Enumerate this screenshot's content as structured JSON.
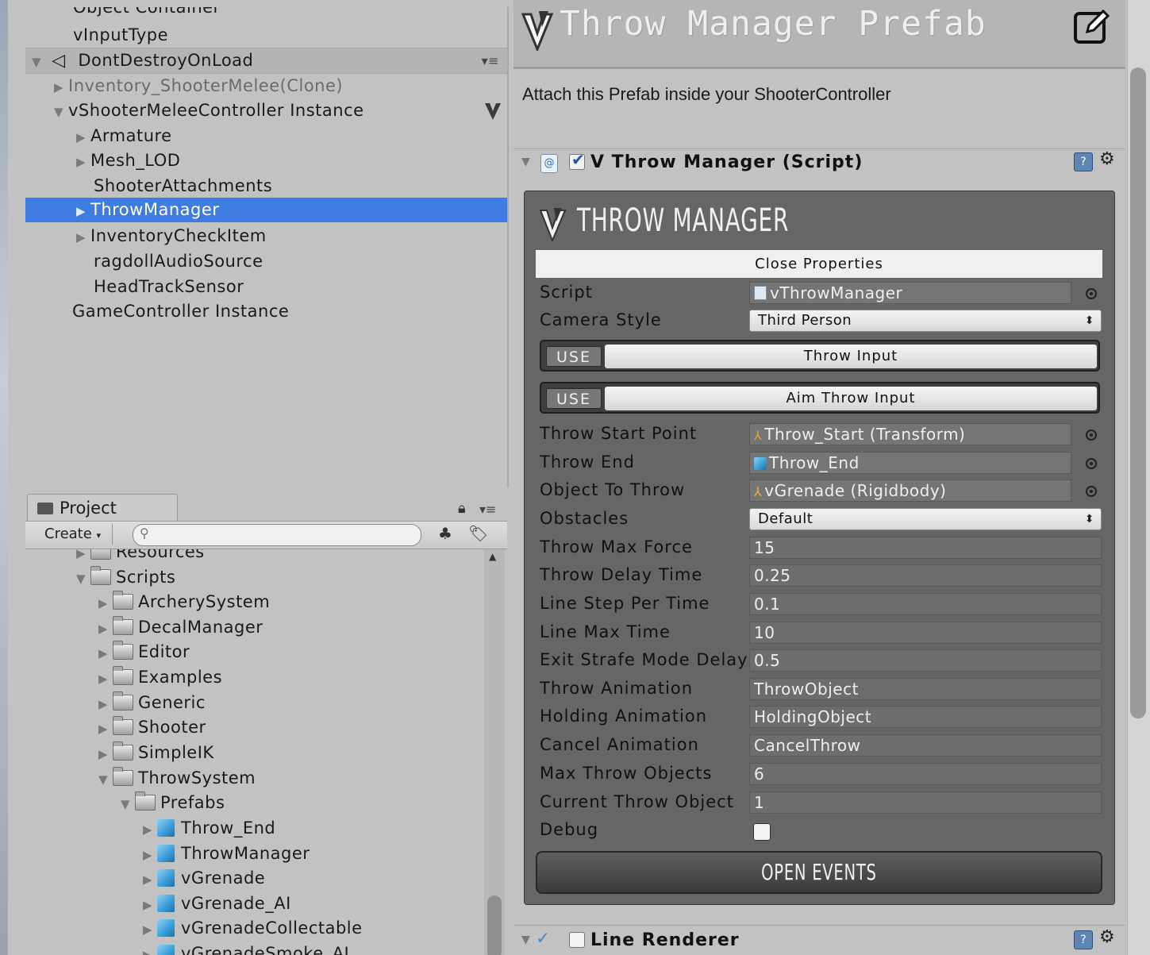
{
  "hierarchy": {
    "rows": [
      {
        "label": "Object Container"
      },
      {
        "label": "vInputType"
      },
      {
        "label": "DontDestroyOnLoad"
      },
      {
        "label": "Inventory_ShooterMelee(Clone)"
      },
      {
        "label": "vShooterMeleeController Instance"
      },
      {
        "label": "Armature"
      },
      {
        "label": "Mesh_LOD"
      },
      {
        "label": "ShooterAttachments"
      },
      {
        "label": "ThrowManager"
      },
      {
        "label": "InventoryCheckItem"
      },
      {
        "label": "ragdollAudioSource"
      },
      {
        "label": "HeadTrackSensor"
      },
      {
        "label": "GameController Instance"
      }
    ],
    "selected": "ThrowManager"
  },
  "project": {
    "tab_label": "Project",
    "create_label": "Create",
    "search_placeholder": "",
    "rows": [
      {
        "label": "Resources",
        "kind": "folder"
      },
      {
        "label": "Scripts",
        "kind": "folder"
      },
      {
        "label": "ArcherySystem",
        "kind": "folder"
      },
      {
        "label": "DecalManager",
        "kind": "folder"
      },
      {
        "label": "Editor",
        "kind": "folder"
      },
      {
        "label": "Examples",
        "kind": "folder"
      },
      {
        "label": "Generic",
        "kind": "folder"
      },
      {
        "label": "Shooter",
        "kind": "folder"
      },
      {
        "label": "SimpleIK",
        "kind": "folder"
      },
      {
        "label": "ThrowSystem",
        "kind": "folder"
      },
      {
        "label": "Prefabs",
        "kind": "folder"
      },
      {
        "label": "Throw_End",
        "kind": "prefab"
      },
      {
        "label": "ThrowManager",
        "kind": "prefab"
      },
      {
        "label": "vGrenade",
        "kind": "prefab"
      },
      {
        "label": "vGrenade_AI",
        "kind": "prefab"
      },
      {
        "label": "vGrenadeCollectable",
        "kind": "prefab"
      },
      {
        "label": "vGrenadeSmoke_AI",
        "kind": "prefab"
      }
    ]
  },
  "inspector": {
    "title": "Throw Manager Prefab",
    "description": "Attach this Prefab inside your ShooterController",
    "component_title": "V Throw Manager (Script)",
    "logo_text": "THROW MANAGER",
    "close_properties": "Close Properties",
    "fields": {
      "script": {
        "label": "Script",
        "value": "vThrowManager"
      },
      "camera_style": {
        "label": "Camera Style",
        "value": "Third Person"
      },
      "throw_input": {
        "use": "USE",
        "label": "Throw Input"
      },
      "aim_throw_input": {
        "use": "USE",
        "label": "Aim Throw Input"
      },
      "throw_start_point": {
        "label": "Throw Start Point",
        "value": "Throw_Start (Transform)"
      },
      "throw_end": {
        "label": "Throw End",
        "value": "Throw_End"
      },
      "object_to_throw": {
        "label": "Object To Throw",
        "value": "vGrenade (Rigidbody)"
      },
      "obstacles": {
        "label": "Obstacles",
        "value": "Default"
      },
      "throw_max_force": {
        "label": "Throw Max Force",
        "value": "15"
      },
      "throw_delay_time": {
        "label": "Throw Delay Time",
        "value": "0.25"
      },
      "line_step_per_time": {
        "label": "Line Step Per Time",
        "value": "0.1"
      },
      "line_max_time": {
        "label": "Line Max Time",
        "value": "10"
      },
      "exit_strafe_mode_delay": {
        "label": "Exit Strafe Mode Delay",
        "value": "0.5"
      },
      "throw_animation": {
        "label": "Throw Animation",
        "value": "ThrowObject"
      },
      "holding_animation": {
        "label": "Holding Animation",
        "value": "HoldingObject"
      },
      "cancel_animation": {
        "label": "Cancel Animation",
        "value": "CancelThrow"
      },
      "max_throw_objects": {
        "label": "Max Throw Objects",
        "value": "6"
      },
      "current_throw_object": {
        "label": "Current Throw Object",
        "value": "1"
      },
      "debug": {
        "label": "Debug",
        "checked": false
      }
    },
    "open_events": "OPEN EVENTS",
    "line_renderer_title": "Line Renderer"
  },
  "colors": {
    "selection": "#3e7ce1",
    "panel_bg": "#c2c2c2",
    "throw_box_bg": "#666666",
    "field_bg": "#6d6d6d"
  }
}
